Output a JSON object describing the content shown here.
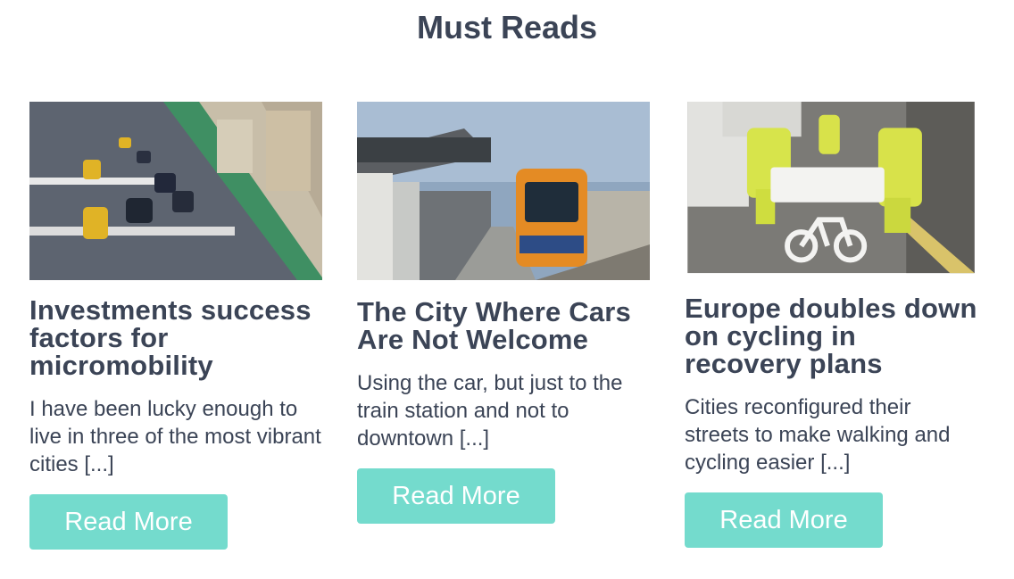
{
  "section": {
    "title": "Must Reads"
  },
  "articles": [
    {
      "title": "Investments success factors for micromobility",
      "excerpt": "I have been lucky enough to live in three of the most vibrant cities  [...]",
      "button": "Read More"
    },
    {
      "title": "The City Where Cars Are Not Welcome",
      "excerpt": "Using the car, but just to the train station and not to downtown [...]",
      "button": "Read More"
    },
    {
      "title": "Europe doubles down on cycling in recovery plans",
      "excerpt": "Cities reconfigured their streets to make walking and cycling easier [...]",
      "button": "Read More"
    }
  ],
  "colors": {
    "heading": "#3b4456",
    "button": "#74dbcd",
    "button_text": "#ffffff"
  }
}
